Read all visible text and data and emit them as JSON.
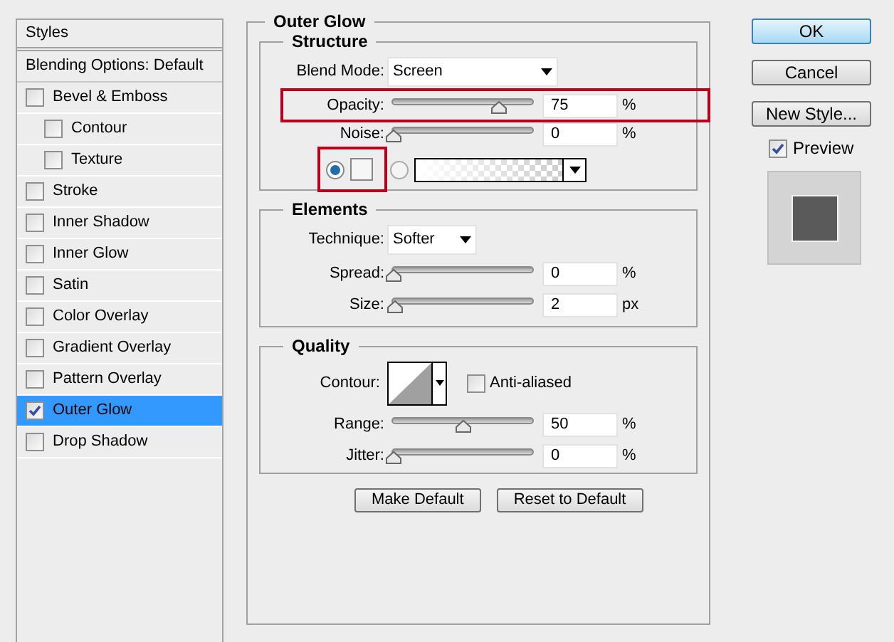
{
  "sidebar": {
    "title": "Styles",
    "items": [
      {
        "label": "Blending Options: Default",
        "kind": "header",
        "selected": false
      },
      {
        "label": "Bevel & Emboss",
        "kind": "check",
        "checked": false,
        "selected": false,
        "children": [
          {
            "label": "Contour",
            "kind": "check",
            "checked": false,
            "selected": false
          },
          {
            "label": "Texture",
            "kind": "check",
            "checked": false,
            "selected": false
          }
        ]
      },
      {
        "label": "Stroke",
        "kind": "check",
        "checked": false,
        "selected": false
      },
      {
        "label": "Inner Shadow",
        "kind": "check",
        "checked": false,
        "selected": false
      },
      {
        "label": "Inner Glow",
        "kind": "check",
        "checked": false,
        "selected": false
      },
      {
        "label": "Satin",
        "kind": "check",
        "checked": false,
        "selected": false
      },
      {
        "label": "Color Overlay",
        "kind": "check",
        "checked": false,
        "selected": false
      },
      {
        "label": "Gradient Overlay",
        "kind": "check",
        "checked": false,
        "selected": false
      },
      {
        "label": "Pattern Overlay",
        "kind": "check",
        "checked": false,
        "selected": false
      },
      {
        "label": "Outer Glow",
        "kind": "check",
        "checked": true,
        "selected": true
      },
      {
        "label": "Drop Shadow",
        "kind": "check",
        "checked": false,
        "selected": false
      }
    ]
  },
  "panel": {
    "title": "Outer Glow",
    "structure": {
      "title": "Structure",
      "blend_mode": {
        "label": "Blend Mode:",
        "value": "Screen"
      },
      "sliders": [
        {
          "label": "Opacity:",
          "level": 0.75,
          "value": "75",
          "unit": "%",
          "highlighted": true
        },
        {
          "label": "Noise:",
          "level": 0,
          "value": "0",
          "unit": "%",
          "highlighted": false
        }
      ],
      "fill": {
        "color_selected": true,
        "gradient_selected": false,
        "highlighted": true
      }
    },
    "elements": {
      "title": "Elements",
      "technique": {
        "label": "Technique:",
        "value": "Softer"
      },
      "sliders": [
        {
          "label": "Spread:",
          "level": 0,
          "value": "0",
          "unit": "%"
        },
        {
          "label": "Size:",
          "level": 0.01,
          "value": "2",
          "unit": "px"
        }
      ]
    },
    "quality": {
      "title": "Quality",
      "contour_label": "Contour:",
      "anti_aliased": {
        "label": "Anti-aliased",
        "checked": false
      },
      "sliders": [
        {
          "label": "Range:",
          "level": 0.5,
          "value": "50",
          "unit": "%"
        },
        {
          "label": "Jitter:",
          "level": 0,
          "value": "0",
          "unit": "%"
        }
      ]
    },
    "buttons": [
      "Make Default",
      "Reset to Default"
    ]
  },
  "actions": [
    {
      "label": "OK",
      "kind": "default"
    },
    {
      "label": "Cancel",
      "kind": "normal"
    },
    {
      "label": "New Style...",
      "kind": "normal"
    }
  ],
  "preview": {
    "label": "Preview",
    "checked": true
  }
}
